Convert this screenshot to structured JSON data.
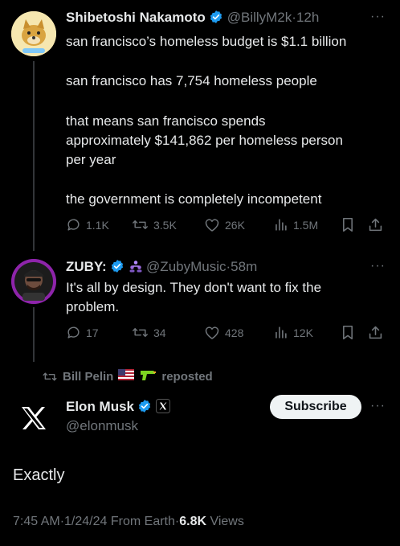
{
  "tweet1": {
    "name": "Shibetoshi Nakamoto",
    "handle": "@BillyM2k",
    "time": "12h",
    "lines": [
      "san francisco’s homeless budget is $1.1 billion",
      "san francisco has 7,754 homeless people",
      "that means san francisco spends",
      "approximately $141,862 per homeless person",
      "per year",
      "the government is completely incompetent"
    ],
    "replies": "1.1K",
    "reposts": "3.5K",
    "likes": "26K",
    "views": "1.5M"
  },
  "tweet2": {
    "name": "ZUBY:",
    "handle": "@ZubyMusic",
    "time": "58m",
    "lines": [
      "It's all by design. They don't want to fix the",
      "problem."
    ],
    "replies": "17",
    "reposts": "34",
    "likes": "428",
    "views": "12K"
  },
  "repost_bar": {
    "reposter": "Bill Pelin",
    "suffix": "reposted"
  },
  "main_tweet": {
    "name": "Elon Musk",
    "handle": "@elonmusk",
    "subscribe_label": "Subscribe",
    "text": "Exactly",
    "time": "7:45 AM",
    "date": "1/24/24",
    "source": "From Earth",
    "views_count": "6.8K",
    "views_label": "Views"
  },
  "separator": "·",
  "more": "···",
  "colors": {
    "background": "#000000",
    "text": "#e7e9ea",
    "secondary": "#71767b",
    "verified_blue": "#1d9bf0"
  }
}
